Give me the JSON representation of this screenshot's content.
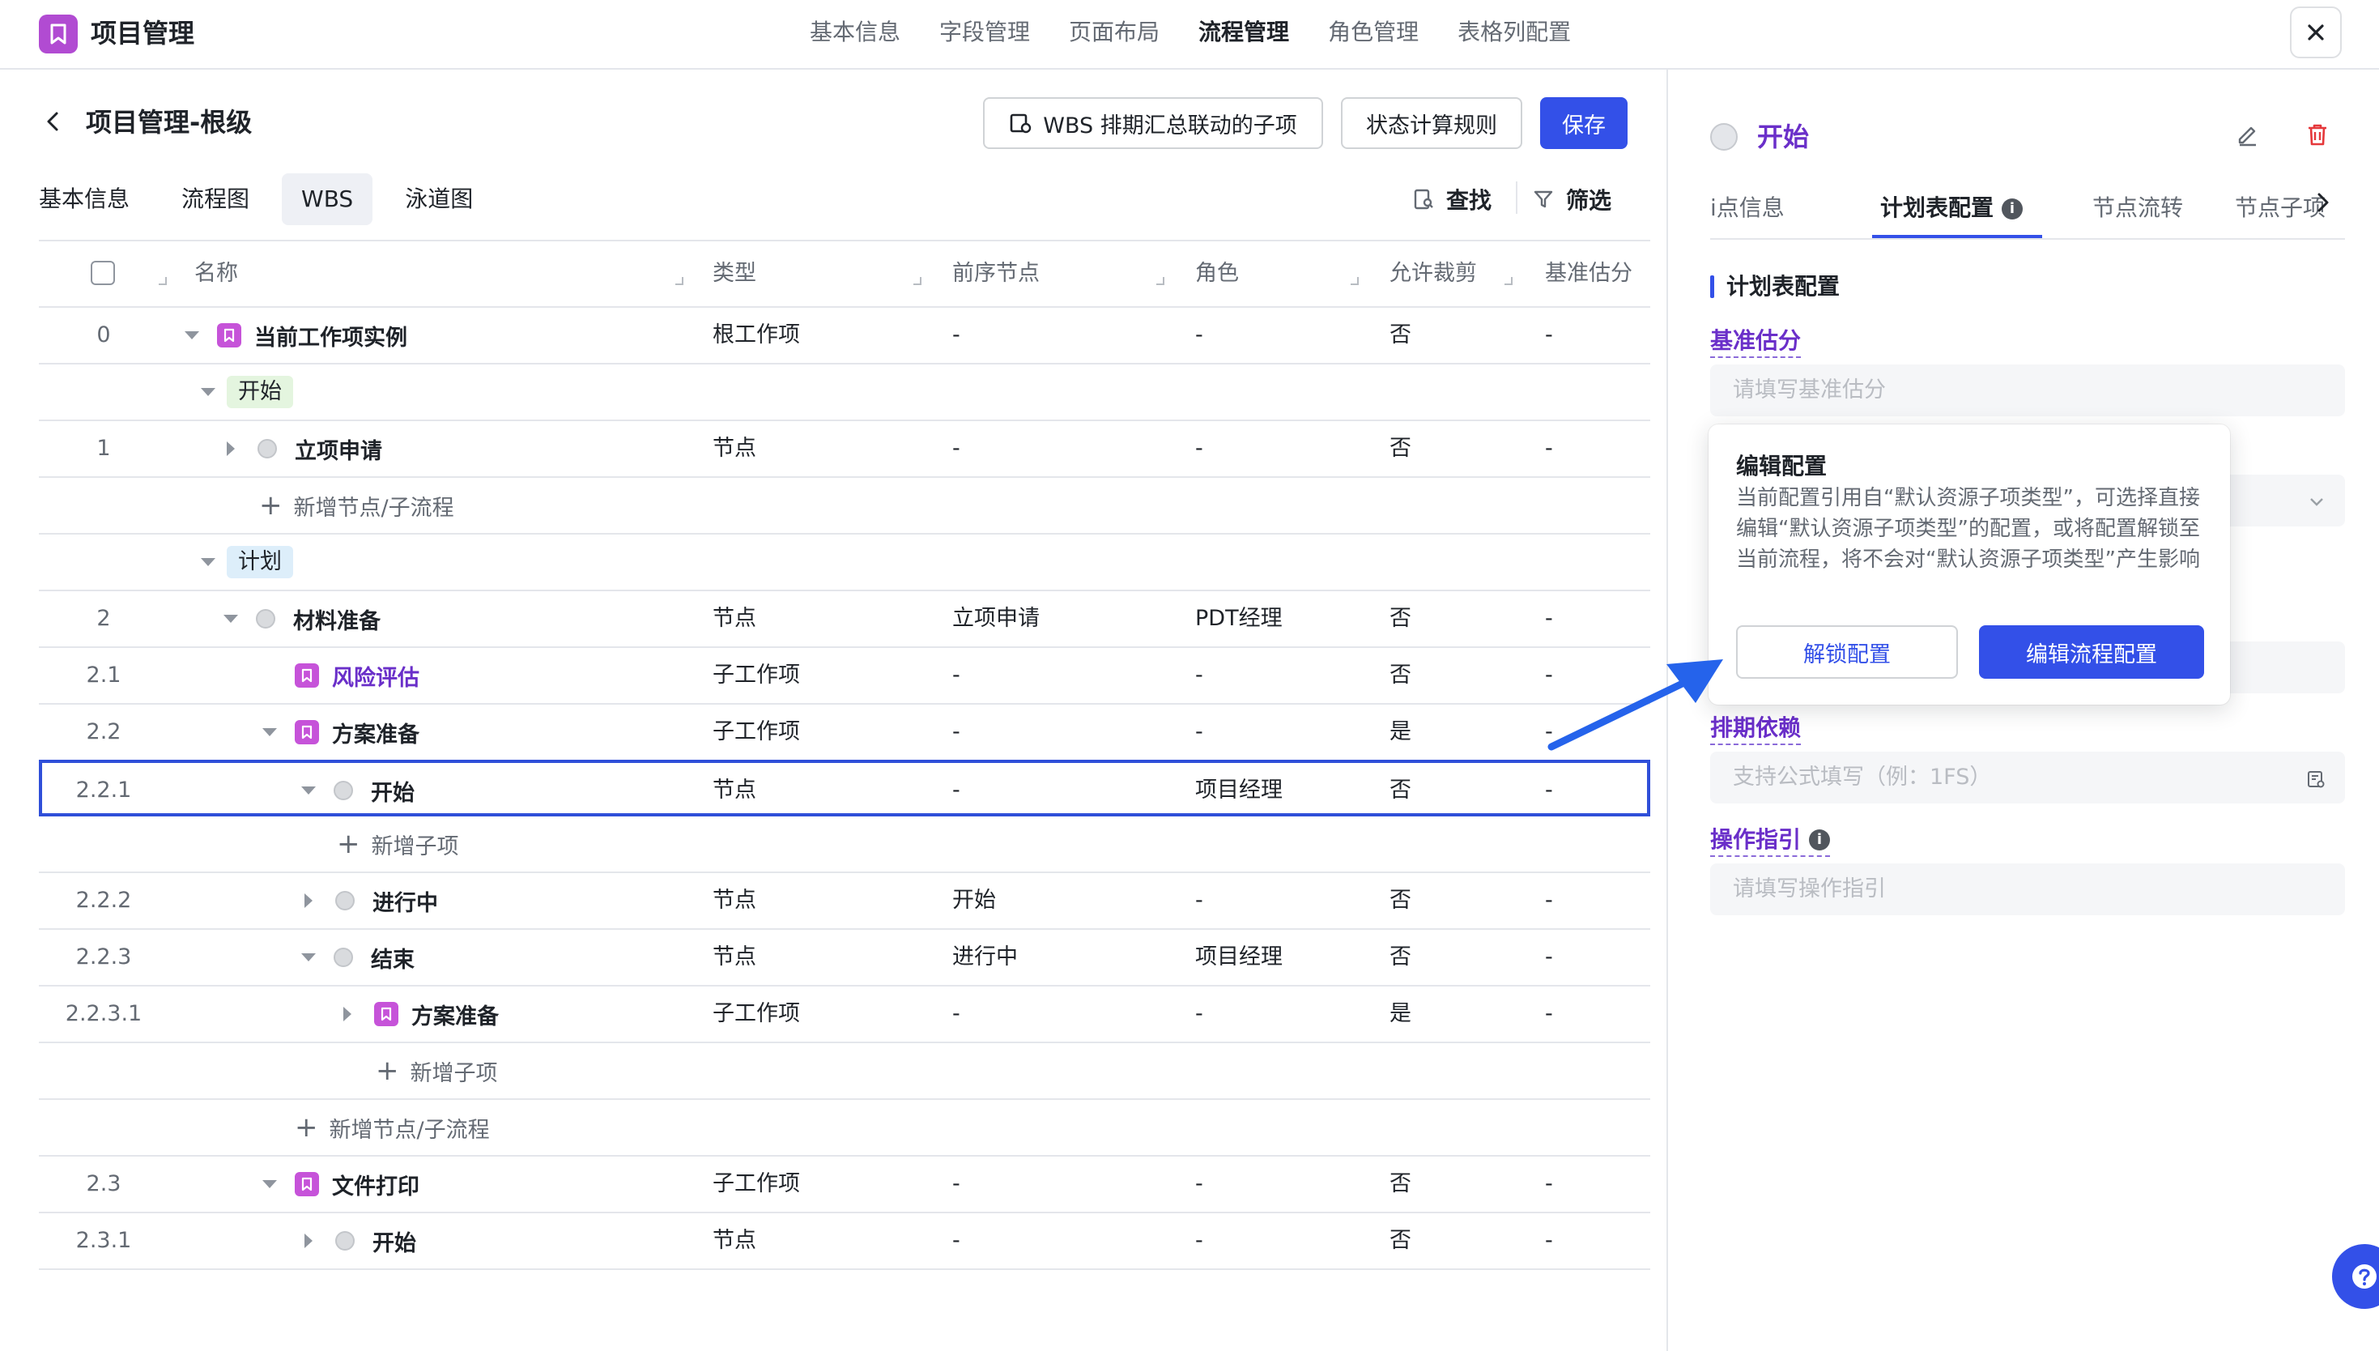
{
  "app": {
    "title": "项目管理"
  },
  "top_nav": [
    {
      "label": "基本信息",
      "active": false
    },
    {
      "label": "字段管理",
      "active": false
    },
    {
      "label": "页面布局",
      "active": false
    },
    {
      "label": "流程管理",
      "active": true
    },
    {
      "label": "角色管理",
      "active": false
    },
    {
      "label": "表格列配置",
      "active": false
    }
  ],
  "page": {
    "title": "项目管理-根级",
    "wbs_button": "WBS 排期汇总联动的子项",
    "status_rule_button": "状态计算规则",
    "save_button": "保存"
  },
  "sub_tabs": [
    {
      "label": "基本信息",
      "active": false
    },
    {
      "label": "流程图",
      "active": false
    },
    {
      "label": "WBS",
      "active": true
    },
    {
      "label": "泳道图",
      "active": false
    }
  ],
  "toolbar": {
    "find": "查找",
    "filter": "筛选"
  },
  "table": {
    "columns": {
      "name": "名称",
      "type": "类型",
      "predecessor": "前序节点",
      "role": "角色",
      "allow_crop": "允许裁剪",
      "base_estimate": "基准估分"
    },
    "rows": [
      {
        "kind": "item",
        "idx": "0",
        "level": 0,
        "toggle": "down",
        "icon": "work",
        "name": "当前工作项实例",
        "type": "根工作项",
        "pred": "-",
        "role": "-",
        "crop": "否",
        "base": "-"
      },
      {
        "kind": "stage",
        "level": 0,
        "name": "开始",
        "color": "green"
      },
      {
        "kind": "item",
        "idx": "1",
        "level": 1,
        "toggle": "right",
        "icon": "node",
        "name": "立项申请",
        "type": "节点",
        "pred": "-",
        "role": "-",
        "crop": "否",
        "base": "-"
      },
      {
        "kind": "add",
        "level": 1,
        "label": "新增节点/子流程"
      },
      {
        "kind": "stage",
        "level": 0,
        "name": "计划",
        "color": "blue"
      },
      {
        "kind": "item",
        "idx": "2",
        "level": 1,
        "toggle": "down",
        "icon": "node",
        "name": "材料准备",
        "type": "节点",
        "pred": "立项申请",
        "role": "PDT经理",
        "crop": "否",
        "base": "-"
      },
      {
        "kind": "item",
        "idx": "2.1",
        "level": 2,
        "toggle": "none",
        "icon": "work",
        "name": "风险评估",
        "link": true,
        "type": "子工作项",
        "pred": "-",
        "role": "-",
        "crop": "否",
        "base": "-"
      },
      {
        "kind": "item",
        "idx": "2.2",
        "level": 2,
        "toggle": "down",
        "icon": "work",
        "name": "方案准备",
        "type": "子工作项",
        "pred": "-",
        "role": "-",
        "crop": "是",
        "base": "-"
      },
      {
        "kind": "item",
        "idx": "2.2.1",
        "level": 3,
        "toggle": "down",
        "icon": "node",
        "name": "开始",
        "type": "节点",
        "pred": "-",
        "role": "项目经理",
        "crop": "否",
        "base": "-",
        "selected": true
      },
      {
        "kind": "add",
        "level": 3,
        "label": "新增子项"
      },
      {
        "kind": "item",
        "idx": "2.2.2",
        "level": 3,
        "toggle": "right",
        "icon": "node",
        "name": "进行中",
        "type": "节点",
        "pred": "开始",
        "role": "-",
        "crop": "否",
        "base": "-"
      },
      {
        "kind": "item",
        "idx": "2.2.3",
        "level": 3,
        "toggle": "down",
        "icon": "node",
        "name": "结束",
        "type": "节点",
        "pred": "进行中",
        "role": "项目经理",
        "crop": "否",
        "base": "-"
      },
      {
        "kind": "item",
        "idx": "2.2.3.1",
        "level": 4,
        "toggle": "right",
        "icon": "work",
        "name": "方案准备",
        "type": "子工作项",
        "pred": "-",
        "role": "-",
        "crop": "是",
        "base": "-"
      },
      {
        "kind": "add",
        "level": 4,
        "label": "新增子项"
      },
      {
        "kind": "add",
        "level": 3,
        "offset": "back",
        "label": "新增节点/子流程"
      },
      {
        "kind": "item",
        "idx": "2.3",
        "level": 2,
        "toggle": "down",
        "icon": "work",
        "name": "文件打印",
        "type": "子工作项",
        "pred": "-",
        "role": "-",
        "crop": "否",
        "base": "-"
      },
      {
        "kind": "item",
        "idx": "2.3.1",
        "level": 3,
        "toggle": "right",
        "icon": "node",
        "name": "开始",
        "type": "节点",
        "pred": "-",
        "role": "-",
        "crop": "否",
        "base": "-"
      }
    ]
  },
  "right_panel": {
    "node_title": "开始",
    "tabs": [
      {
        "label": "节点信息",
        "visible_label": "i点信息",
        "active": false
      },
      {
        "label": "计划表配置",
        "active": true
      },
      {
        "label": "节点流转",
        "active": false
      },
      {
        "label": "节点子项",
        "active": false
      }
    ],
    "section_title": "计划表配置",
    "fields": {
      "base_estimate_label": "基准估分",
      "base_estimate_placeholder": "请填写基准估分",
      "schedule_dep_label": "排期依赖",
      "schedule_dep_placeholder": "支持公式填写（例：1FS）",
      "guide_label": "操作指引",
      "guide_placeholder": "请填写操作指引"
    },
    "popover": {
      "title": "编辑配置",
      "body": "当前配置引用自“默认资源子项类型”，可选择直接编辑“默认资源子项类型”的配置，或将配置解锁至当前流程，将不会对“默认资源子项类型”产生影响",
      "unlock_button": "解锁配置",
      "edit_button": "编辑流程配置"
    }
  },
  "colors": {
    "accent": "#3350e8",
    "brand_purple": "#b14bd2",
    "link_purple": "#6a2fc9",
    "delete_red": "#e5383b"
  }
}
